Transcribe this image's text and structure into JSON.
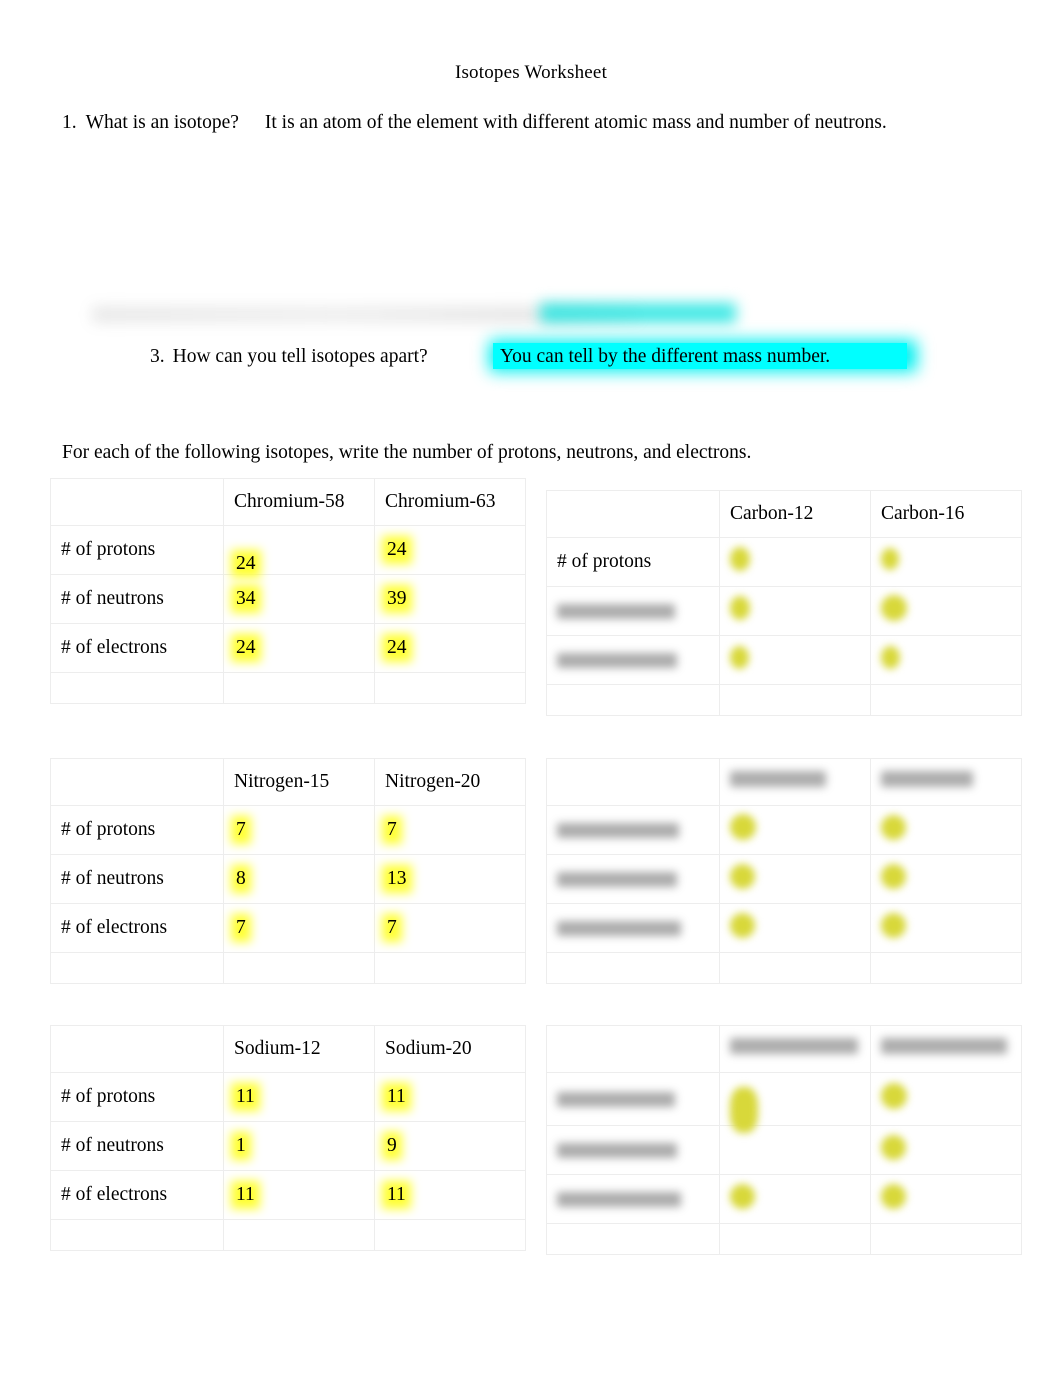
{
  "document": {
    "title": "Isotopes Worksheet"
  },
  "questions": [
    {
      "number": "1.",
      "prompt": "What is an isotope?",
      "answer": "It is an atom of the element with different atomic mass and number of neutrons.",
      "redacted": false
    },
    {
      "number": "",
      "prompt": "",
      "answer": "",
      "redacted": true
    },
    {
      "number": "3.",
      "prompt": "How can you tell isotopes apart?",
      "answer": "You can tell by the different mass number.",
      "answer_highlight_color": "#00ffff",
      "redacted": false
    }
  ],
  "instruction": "For each of the following isotopes, write the number of protons, neutrons, and electrons.",
  "row_labels": [
    "# of protons",
    "# of neutrons",
    "# of electrons"
  ],
  "highlight_color": "#ffff33",
  "tables": [
    {
      "id": "chromium",
      "redacted": false,
      "corner_label": "",
      "columns": [
        "Chromium-58",
        "Chromium-63"
      ],
      "rows": [
        {
          "label": "# of protons",
          "values": [
            "24",
            "24"
          ]
        },
        {
          "label": "# of neutrons",
          "values": [
            "34",
            "39"
          ]
        },
        {
          "label": "# of electrons",
          "values": [
            "24",
            "24"
          ]
        }
      ],
      "note": "first column protons value is written low, overlapping the neutrons row"
    },
    {
      "id": "carbon",
      "redacted": true,
      "corner_label": "",
      "columns": [
        "Carbon-12",
        "Carbon-16"
      ],
      "rows": [
        {
          "label": "# of protons",
          "values": [
            "",
            ""
          ],
          "label_redacted": false
        },
        {
          "label": "",
          "values": [
            "",
            ""
          ],
          "label_redacted": true
        },
        {
          "label": "",
          "values": [
            "",
            ""
          ],
          "label_redacted": true
        }
      ]
    },
    {
      "id": "nitrogen",
      "redacted": false,
      "corner_label": "",
      "columns": [
        "Nitrogen-15",
        "Nitrogen-20"
      ],
      "rows": [
        {
          "label": "# of protons",
          "values": [
            "7",
            "7"
          ]
        },
        {
          "label": "# of neutrons",
          "values": [
            "8",
            "13"
          ]
        },
        {
          "label": "# of electrons",
          "values": [
            "7",
            "7"
          ]
        }
      ]
    },
    {
      "id": "unknown-upper-right",
      "redacted": true,
      "corner_label": "",
      "columns": [
        "",
        ""
      ],
      "rows": [
        {
          "label": "",
          "values": [
            "",
            ""
          ],
          "label_redacted": true
        },
        {
          "label": "",
          "values": [
            "",
            ""
          ],
          "label_redacted": true
        },
        {
          "label": "",
          "values": [
            "",
            ""
          ],
          "label_redacted": true
        }
      ]
    },
    {
      "id": "sodium",
      "redacted": false,
      "corner_label": "",
      "columns": [
        "Sodium-12",
        "Sodium-20"
      ],
      "rows": [
        {
          "label": "# of protons",
          "values": [
            "11",
            "11"
          ]
        },
        {
          "label": "# of neutrons",
          "values": [
            "1",
            "9"
          ]
        },
        {
          "label": "# of electrons",
          "values": [
            "11",
            "11"
          ]
        }
      ]
    },
    {
      "id": "unknown-lower-right",
      "redacted": true,
      "corner_label": "",
      "columns": [
        "",
        ""
      ],
      "rows": [
        {
          "label": "",
          "values": [
            "",
            ""
          ],
          "label_redacted": true
        },
        {
          "label": "",
          "values": [
            "",
            ""
          ],
          "label_redacted": true
        },
        {
          "label": "",
          "values": [
            "",
            ""
          ],
          "label_redacted": true
        }
      ]
    }
  ]
}
